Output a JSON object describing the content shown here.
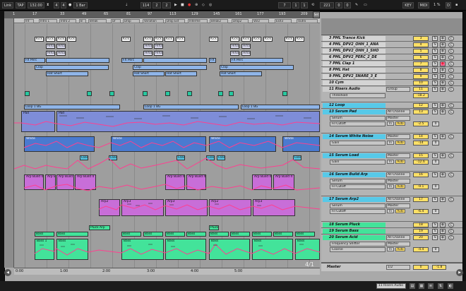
{
  "transport": {
    "link": "Link",
    "tap": "TAP",
    "tempo": "132.00",
    "sig_num": "4",
    "sig_den": "4",
    "quantize": "1 Bar",
    "position": [
      "114",
      "2",
      "2"
    ],
    "loop_start": [
      "7",
      "1",
      "1"
    ],
    "loop_length": [
      "221",
      "0",
      "0"
    ],
    "key_label": "KEY",
    "midi_label": "MIDI",
    "percent": "1 %",
    "d_label": "D"
  },
  "arrangement": {
    "bar_numbers": [
      "1",
      "17",
      "33",
      "49",
      "65",
      "81",
      "97",
      "113",
      "129",
      "145",
      "161",
      "177",
      "193",
      "209"
    ],
    "set_button": "Set",
    "locators": [
      "Int",
      "Intro 1",
      "Intro 2",
      "B",
      "Break",
      "Dr",
      "Drop",
      "Variation",
      "Drop Ext",
      "Interme",
      "Break2",
      "Drop2",
      "Var2",
      "Exit3",
      "Outro"
    ],
    "time_labels": [
      "0:00",
      "1:00",
      "2:00",
      "3:00",
      "4:00",
      "5:00"
    ],
    "time_signature_display": "4/1",
    "clips": {
      "kick": "Kick",
      "hihat": "Hihat",
      "fx_perc": "FX Perc",
      "clap": "Clap",
      "hat_short": "Hat Short",
      "loop_1_bg": "Loop 1 BG",
      "pad": "Pad",
      "white": "White",
      "load": "Load",
      "arp_build_4": "Arp Build 4",
      "arp_build_6": "Arp Build 6",
      "arp2": "Arp2",
      "arp3": "Arp3",
      "pluck_arp": "Pluck Arp",
      "pluck": "Pluck",
      "bass": "Bass",
      "bass_1": "Bass 1"
    }
  },
  "tracks": [
    {
      "name": "3 PML Trance Kick",
      "vol": "3",
      "color": "#ffe066",
      "s": "S",
      "m": "○"
    },
    {
      "name": "4 PML_DPV2_OHH_1_ANA",
      "vol": "4",
      "color": "#ffe066"
    },
    {
      "name": "5 PML_DPV2_OHH_1_SHO",
      "vol": "5",
      "color": "#ffe066"
    },
    {
      "name": "6 PML_DPV2_PERC_2_DE",
      "vol": "6",
      "color": "#ffe066"
    },
    {
      "name": "7 PML Clap 1",
      "vol": "7",
      "color": "#ffe066",
      "armed": true
    },
    {
      "name": "8 PML Hat",
      "vol": "8",
      "color": "#ffe066"
    },
    {
      "name": "9 PML_DPV2_SNARE_3_E",
      "vol": "9",
      "color": "#ffe066"
    },
    {
      "name": "10 Cym",
      "vol": "10",
      "color": "#ffe066"
    },
    {
      "name": "11 Risers Audio",
      "vol": "11",
      "io": "Group",
      "color": "#ffe066",
      "sub": "Threshold",
      "sub_val": "-18.2"
    },
    {
      "name": "12 Loop",
      "vol": "12",
      "color": "#ffe066"
    },
    {
      "name": "13 Serum Pad",
      "vol": "13",
      "io": "All Channe",
      "io2": "Master",
      "sub1": "Serum",
      "sub2": "Fil Cutoff",
      "color": "#ffe066",
      "v2": "-2.5",
      "v3": "0"
    },
    {
      "name": "14 Serum White Noise",
      "vol": "14",
      "io": "Master",
      "sub1": "Gain",
      "color": "#ffe066",
      "v2": "-14",
      "v3": "0"
    },
    {
      "name": "15 Serum Load",
      "vol": "15",
      "io": "Master",
      "sub1": "Gain",
      "color": "#ffe066",
      "v2": "-12.6",
      "v3": "0"
    },
    {
      "name": "16 Serum Build Arp",
      "vol": "16",
      "io": "All Channe",
      "io2": "Master",
      "sub1": "Serum",
      "sub2": "Fil Cutoff",
      "color": "#ffe066",
      "v2": "-9.1",
      "v3": "0"
    },
    {
      "name": "17 Serum Arp2",
      "vol": "17",
      "io": "All Channe",
      "io2": "Master",
      "sub1": "Serum",
      "sub2": "Fil Cutoff",
      "color": "#ffe066",
      "v2": "-6.4",
      "v3": "0"
    },
    {
      "name": "18 Serum Pluck",
      "vol": "18",
      "color": "#ffe066"
    },
    {
      "name": "19 Serum Bass",
      "vol": "19",
      "color": "#ffe066"
    },
    {
      "name": "20 Serum Acid",
      "vol": "20",
      "io": "All Channe",
      "io2": "Master",
      "sub1": "Frequency Shifter",
      "sub2": "Coarse",
      "color": "#ffe066",
      "v2": "-4.4",
      "v3": "0"
    }
  ],
  "master": {
    "name": "Master",
    "io": "1/2",
    "vol": "0",
    "val": "-1.8"
  },
  "status": {
    "text": "11 Risers Audio"
  },
  "colors": {
    "accent": "#ffe066",
    "pink": "#ff4fa0",
    "green": "#43e39a"
  }
}
